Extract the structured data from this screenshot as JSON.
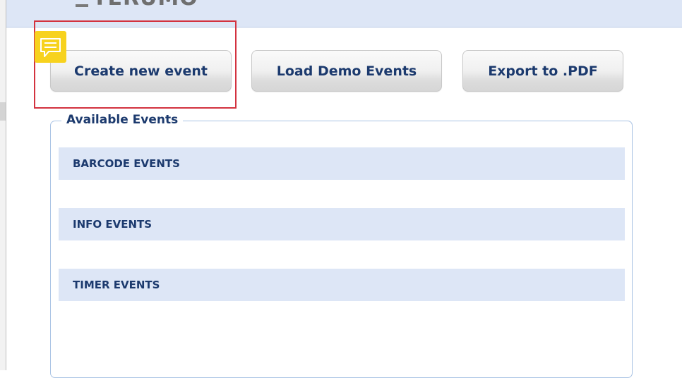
{
  "header": {
    "logo_text": "TERUMO"
  },
  "toolbar": {
    "create_label": "Create new event",
    "demo_label": "Load Demo Events",
    "export_label": "Export to .PDF"
  },
  "events_panel": {
    "legend": "Available Events",
    "categories": [
      {
        "label": "BARCODE EVENTS"
      },
      {
        "label": "INFO EVENTS"
      },
      {
        "label": "TIMER EVENTS"
      }
    ]
  },
  "annotation": {
    "icon": "comment-icon",
    "highlight_color": "#d3323f",
    "icon_color": "#f7d21e"
  },
  "colors": {
    "header_bg": "#dde6f6",
    "text_primary": "#1c3a6e",
    "panel_border": "#a9c3e4"
  }
}
